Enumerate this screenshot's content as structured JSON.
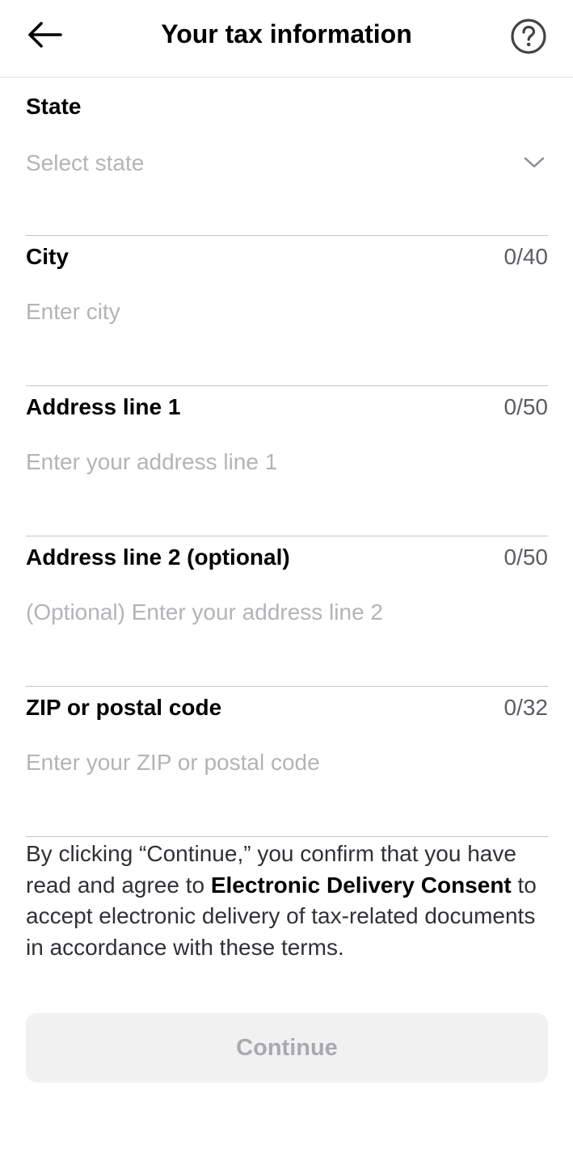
{
  "header": {
    "title": "Your tax information",
    "back_icon": "arrow-left-icon",
    "help_icon": "question-circle-icon"
  },
  "form": {
    "state": {
      "label": "State",
      "placeholder": "Select state",
      "icon": "chevron-down-icon"
    },
    "city": {
      "label": "City",
      "counter": "0/40",
      "value": "",
      "placeholder": "Enter city"
    },
    "address1": {
      "label": "Address line 1",
      "counter": "0/50",
      "value": "",
      "placeholder": "Enter your address line 1"
    },
    "address2": {
      "label": "Address line 2 (optional)",
      "counter": "0/50",
      "value": "",
      "placeholder": "(Optional) Enter your address line 2"
    },
    "zip": {
      "label": "ZIP or postal code",
      "counter": "0/32",
      "value": "",
      "placeholder": "Enter your ZIP or postal code"
    }
  },
  "consent": {
    "prefix": "By clicking “Continue,” you confirm that you have read and agree to ",
    "link": "Electronic Delivery Consent",
    "suffix": " to accept electronic delivery of tax-related documents in accordance with these terms."
  },
  "continue_button": {
    "label": "Continue",
    "enabled": false
  },
  "colors": {
    "text_primary": "#000000",
    "text_placeholder": "#b3b4b7",
    "divider": "#c4c4c6",
    "button_disabled_bg": "#f1f1f2",
    "button_disabled_text": "#a9aaae"
  }
}
